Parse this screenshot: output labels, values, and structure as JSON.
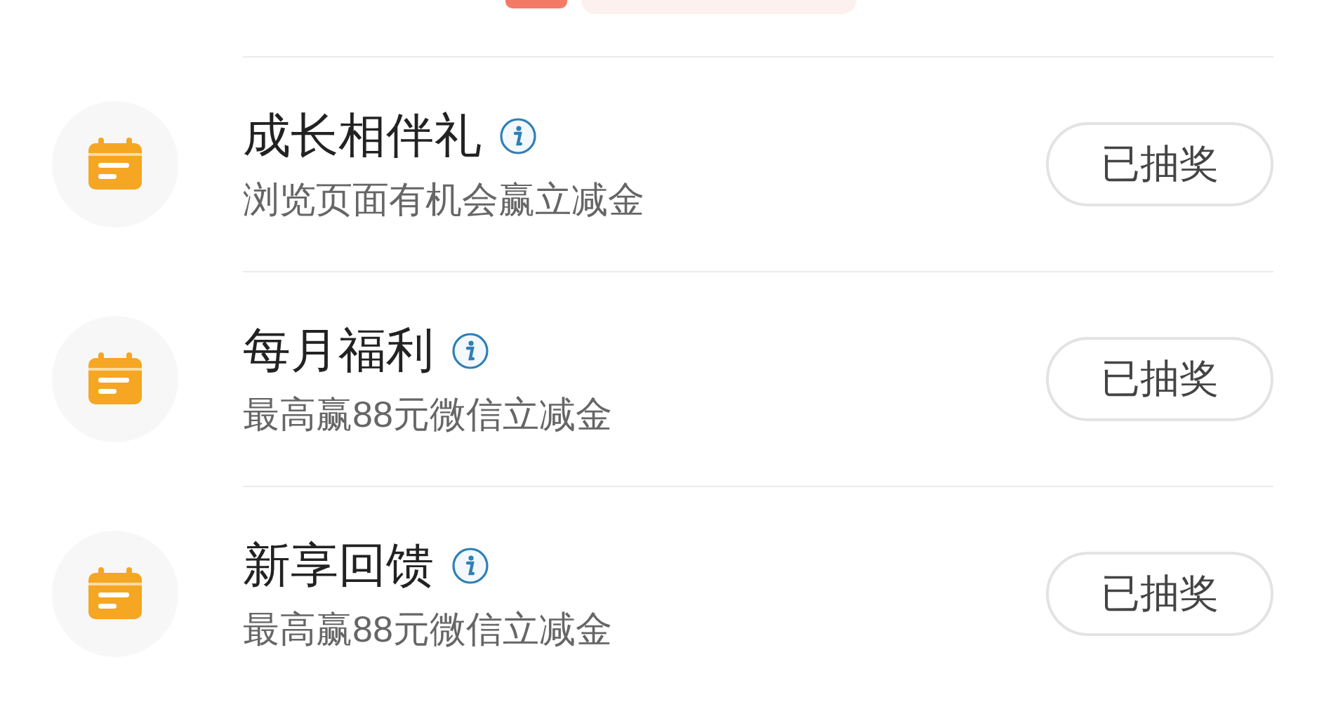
{
  "tasks": [
    {
      "title": "成长相伴礼",
      "subtitle": "浏览页面有机会赢立减金",
      "button": "已抽奖"
    },
    {
      "title": "每月福利",
      "subtitle": "最高赢88元微信立减金",
      "button": "已抽奖"
    },
    {
      "title": "新享回馈",
      "subtitle": "最高赢88元微信立减金",
      "button": "已抽奖"
    }
  ]
}
